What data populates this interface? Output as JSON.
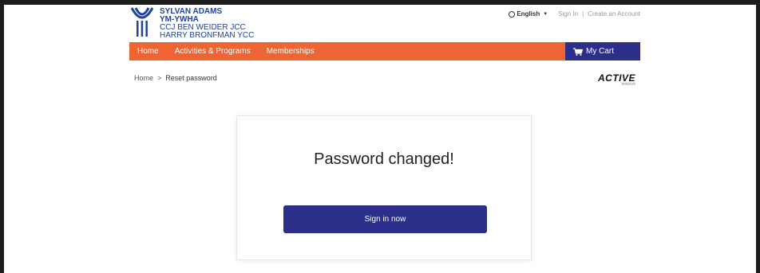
{
  "logo": {
    "line1": "SYLVAN ADAMS",
    "line2": "YM-YWHA",
    "line3": "CCJ BEN WEIDER JCC",
    "line4": "HARRY BRONFMAN YCC"
  },
  "top_links": {
    "language": "English",
    "sign_in": "Sign In",
    "separator": "|",
    "create_account": "Create an Account"
  },
  "nav": {
    "items": [
      {
        "label": "Home"
      },
      {
        "label": "Activities & Programs"
      },
      {
        "label": "Memberships"
      }
    ],
    "cart_label": "My Cart"
  },
  "breadcrumb": {
    "home": "Home",
    "separator": ">",
    "current": "Reset password"
  },
  "brand": {
    "word": "ACTIVE",
    "sub": "network"
  },
  "card": {
    "title": "Password changed!",
    "button_label": "Sign in now"
  },
  "colors": {
    "nav_orange": "#ef6433",
    "primary_navy": "#2b2f89",
    "logo_blue": "#23439a"
  }
}
